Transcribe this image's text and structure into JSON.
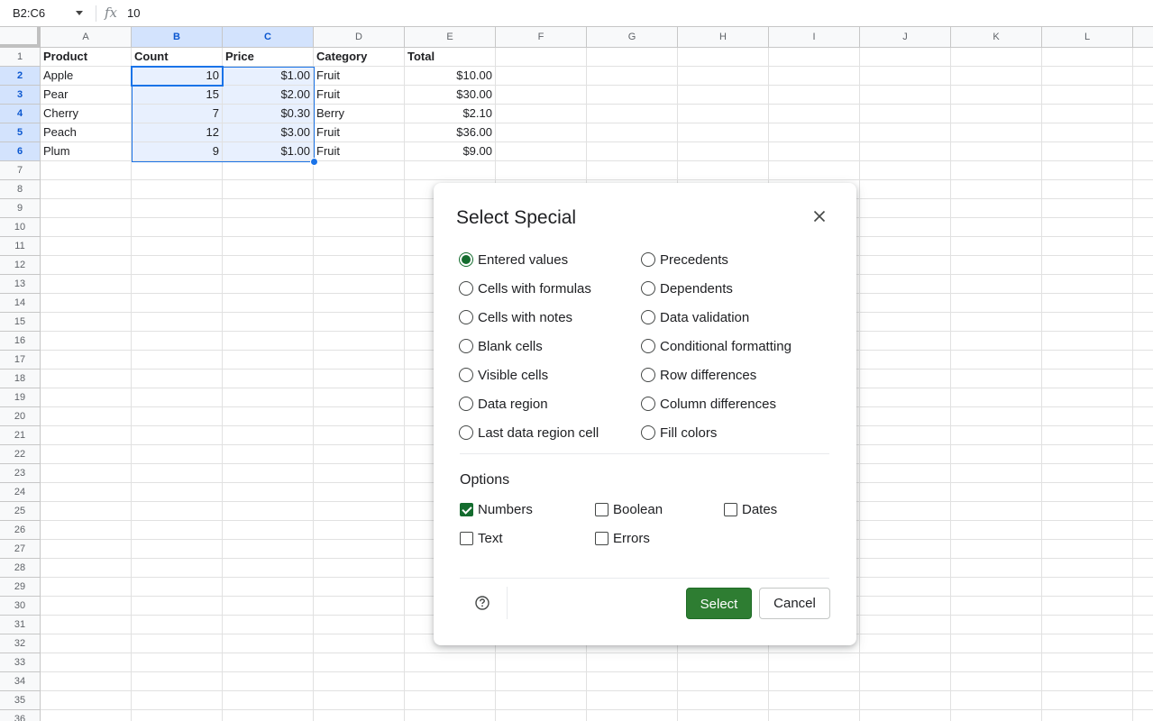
{
  "formula_bar": {
    "name_box": "B2:C6",
    "fx_icon": "fx-icon",
    "formula": "10"
  },
  "sheet": {
    "columns": [
      "A",
      "B",
      "C",
      "D",
      "E",
      "F",
      "G",
      "H",
      "I",
      "J",
      "K",
      "L"
    ],
    "selected_columns": [
      "B",
      "C"
    ],
    "row_count_visible": 36,
    "selected_rows": [
      2,
      3,
      4,
      5,
      6
    ],
    "selection_range": "B2:C6",
    "rows": [
      [
        "Product",
        "Count",
        "Price",
        "Category",
        "Total"
      ],
      [
        "Apple",
        "10",
        "$1.00",
        "Fruit",
        "$10.00"
      ],
      [
        "Pear",
        "15",
        "$2.00",
        "Fruit",
        "$30.00"
      ],
      [
        "Cherry",
        "7",
        "$0.30",
        "Berry",
        "$2.10"
      ],
      [
        "Peach",
        "12",
        "$3.00",
        "Fruit",
        "$36.00"
      ],
      [
        "Plum",
        "9",
        "$1.00",
        "Fruit",
        "$9.00"
      ]
    ]
  },
  "dialog": {
    "title": "Select Special",
    "close_icon": "close-icon",
    "radio_left": [
      "Entered values",
      "Cells with formulas",
      "Cells with notes",
      "Blank cells",
      "Visible cells",
      "Data region",
      "Last data region cell"
    ],
    "radio_right": [
      "Precedents",
      "Dependents",
      "Data validation",
      "Conditional formatting",
      "Row differences",
      "Column differences",
      "Fill colors"
    ],
    "selected_radio": "Entered values",
    "options_title": "Options",
    "options": [
      {
        "label": "Numbers",
        "checked": true
      },
      {
        "label": "Boolean",
        "checked": false
      },
      {
        "label": "Dates",
        "checked": false
      },
      {
        "label": "Text",
        "checked": false
      },
      {
        "label": "Errors",
        "checked": false
      }
    ],
    "help_icon": "help-icon",
    "select_label": "Select",
    "cancel_label": "Cancel",
    "accent_color": "#146c2e"
  }
}
